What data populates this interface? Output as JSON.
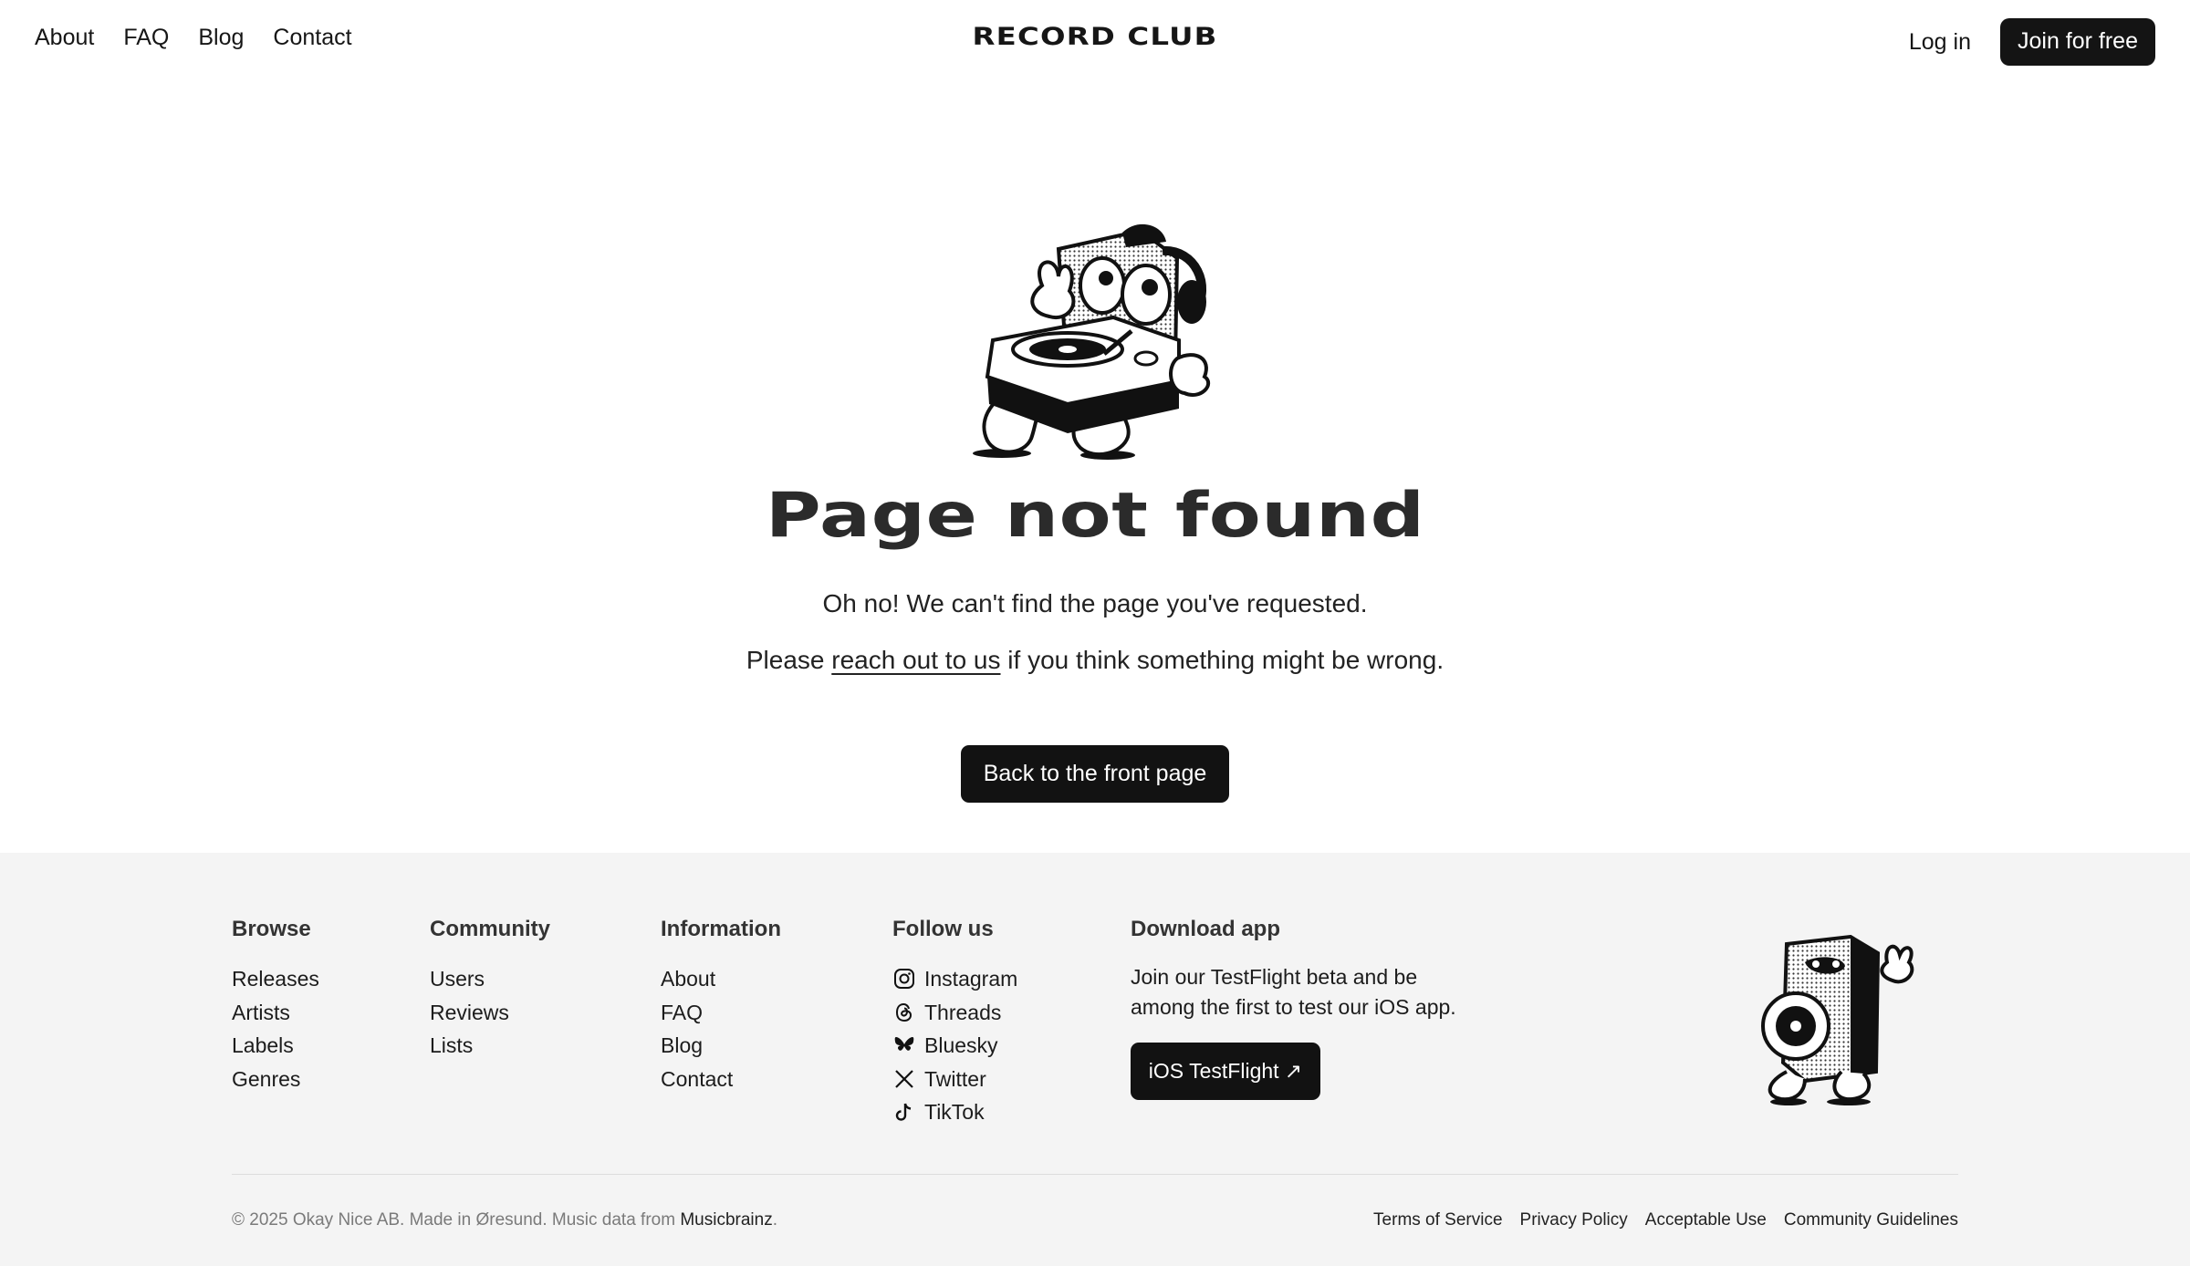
{
  "header": {
    "nav": [
      "About",
      "FAQ",
      "Blog",
      "Contact"
    ],
    "logo": "RECORD CLUB",
    "login": "Log in",
    "join": "Join for free"
  },
  "main": {
    "title": "Page not found",
    "message1": "Oh no! We can't find the page you've requested.",
    "message2_before": "Please ",
    "message2_link": "reach out to us",
    "message2_after": " if you think something might be wrong.",
    "back_button": "Back to the front page"
  },
  "footer": {
    "browse": {
      "heading": "Browse",
      "items": [
        "Releases",
        "Artists",
        "Labels",
        "Genres"
      ]
    },
    "community": {
      "heading": "Community",
      "items": [
        "Users",
        "Reviews",
        "Lists"
      ]
    },
    "information": {
      "heading": "Information",
      "items": [
        "About",
        "FAQ",
        "Blog",
        "Contact"
      ]
    },
    "follow": {
      "heading": "Follow us",
      "items": [
        {
          "label": "Instagram",
          "icon": "instagram-icon"
        },
        {
          "label": "Threads",
          "icon": "threads-icon"
        },
        {
          "label": "Bluesky",
          "icon": "bluesky-icon"
        },
        {
          "label": "Twitter",
          "icon": "twitter-x-icon"
        },
        {
          "label": "TikTok",
          "icon": "tiktok-icon"
        }
      ]
    },
    "download": {
      "heading": "Download app",
      "text": "Join our TestFlight beta and be among the first to test our iOS app.",
      "button": "iOS TestFlight ↗"
    },
    "copyright_text": "© 2025 Okay Nice AB. Made in Øresund. Music data from ",
    "copyright_link": "Musicbrainz",
    "copyright_end": ".",
    "legal": [
      "Terms of Service",
      "Privacy Policy",
      "Acceptable Use",
      "Community Guidelines"
    ]
  },
  "colors": {
    "button_bg": "#121212",
    "footer_bg": "#f4f4f4",
    "text": "#161616"
  }
}
